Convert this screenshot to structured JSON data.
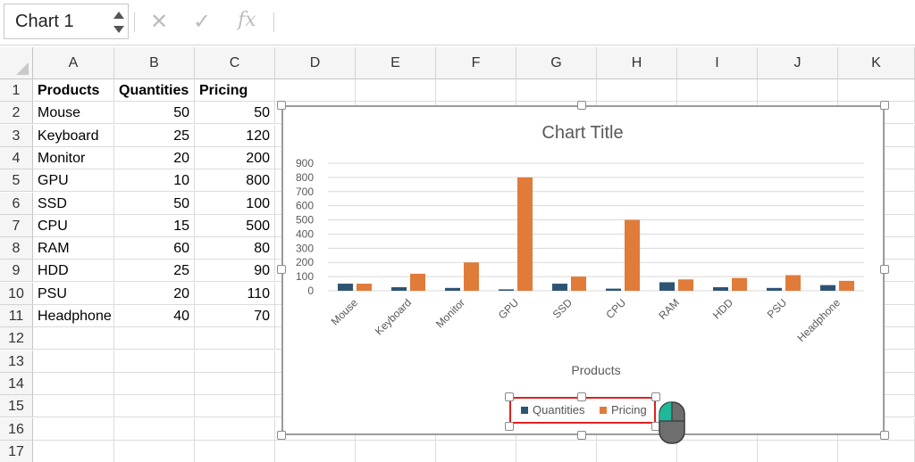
{
  "name_box": {
    "value": "Chart 1"
  },
  "formula_bar": {
    "cancel_icon": "x-icon",
    "enter_icon": "check-icon",
    "function_label": "fx"
  },
  "columns": [
    "A",
    "B",
    "C",
    "D",
    "E",
    "F",
    "G",
    "H",
    "I",
    "J",
    "K"
  ],
  "rows": [
    "1",
    "2",
    "3",
    "4",
    "5",
    "6",
    "7",
    "8",
    "9",
    "10",
    "11",
    "12",
    "13",
    "14",
    "15",
    "16",
    "17"
  ],
  "table": {
    "headers": [
      "Products",
      "Quantities",
      "Pricing"
    ],
    "rows": [
      [
        "Mouse",
        "50",
        "50"
      ],
      [
        "Keyboard",
        "25",
        "120"
      ],
      [
        "Monitor",
        "20",
        "200"
      ],
      [
        "GPU",
        "10",
        "800"
      ],
      [
        "SSD",
        "50",
        "100"
      ],
      [
        "CPU",
        "15",
        "500"
      ],
      [
        "RAM",
        "60",
        "80"
      ],
      [
        "HDD",
        "25",
        "90"
      ],
      [
        "PSU",
        "20",
        "110"
      ],
      [
        "Headphone",
        "40",
        "70"
      ]
    ]
  },
  "chart_data": {
    "type": "bar",
    "title": "Chart Title",
    "xlabel": "Products",
    "ylabel": "",
    "categories": [
      "Mouse",
      "Keyboard",
      "Monitor",
      "GPU",
      "SSD",
      "CPU",
      "RAM",
      "HDD",
      "PSU",
      "Headphone"
    ],
    "series": [
      {
        "name": "Quantities",
        "values": [
          50,
          25,
          20,
          10,
          50,
          15,
          60,
          25,
          20,
          40
        ],
        "color": "#2e5474"
      },
      {
        "name": "Pricing",
        "values": [
          50,
          120,
          200,
          800,
          100,
          500,
          80,
          90,
          110,
          70
        ],
        "color": "#e07b39"
      }
    ],
    "ylim": [
      0,
      900
    ],
    "yticks": [
      "0",
      "100",
      "200",
      "300",
      "400",
      "500",
      "600",
      "700",
      "800",
      "900"
    ],
    "grid": true,
    "legend": "bottom"
  },
  "colors": {
    "selection_highlight": "#e02020",
    "chart_border": "#9b9b9b"
  }
}
